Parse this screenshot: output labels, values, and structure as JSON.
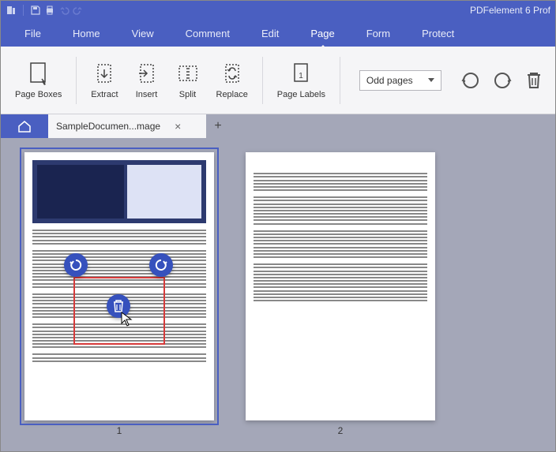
{
  "titlebar": {
    "app_title": "PDFelement 6 Prof"
  },
  "menu": {
    "items": [
      "File",
      "Home",
      "View",
      "Comment",
      "Edit",
      "Page",
      "Form",
      "Protect"
    ],
    "active_index": 5
  },
  "ribbon": {
    "buttons": [
      {
        "id": "page-boxes",
        "label": "Page Boxes"
      },
      {
        "id": "extract",
        "label": "Extract"
      },
      {
        "id": "insert",
        "label": "Insert"
      },
      {
        "id": "split",
        "label": "Split"
      },
      {
        "id": "replace",
        "label": "Replace"
      },
      {
        "id": "page-labels",
        "label": "Page Labels"
      }
    ],
    "page_filter": {
      "selected": "Odd pages"
    },
    "tools": [
      "rotate-ccw",
      "rotate-cw",
      "delete"
    ]
  },
  "tabs": {
    "documents": [
      {
        "title": "SampleDocumen...mage"
      }
    ]
  },
  "pages": {
    "items": [
      {
        "number": "1",
        "selected": true
      },
      {
        "number": "2",
        "selected": false
      }
    ]
  },
  "overlay": {
    "controls": [
      "rotate-left",
      "rotate-right",
      "delete"
    ]
  }
}
